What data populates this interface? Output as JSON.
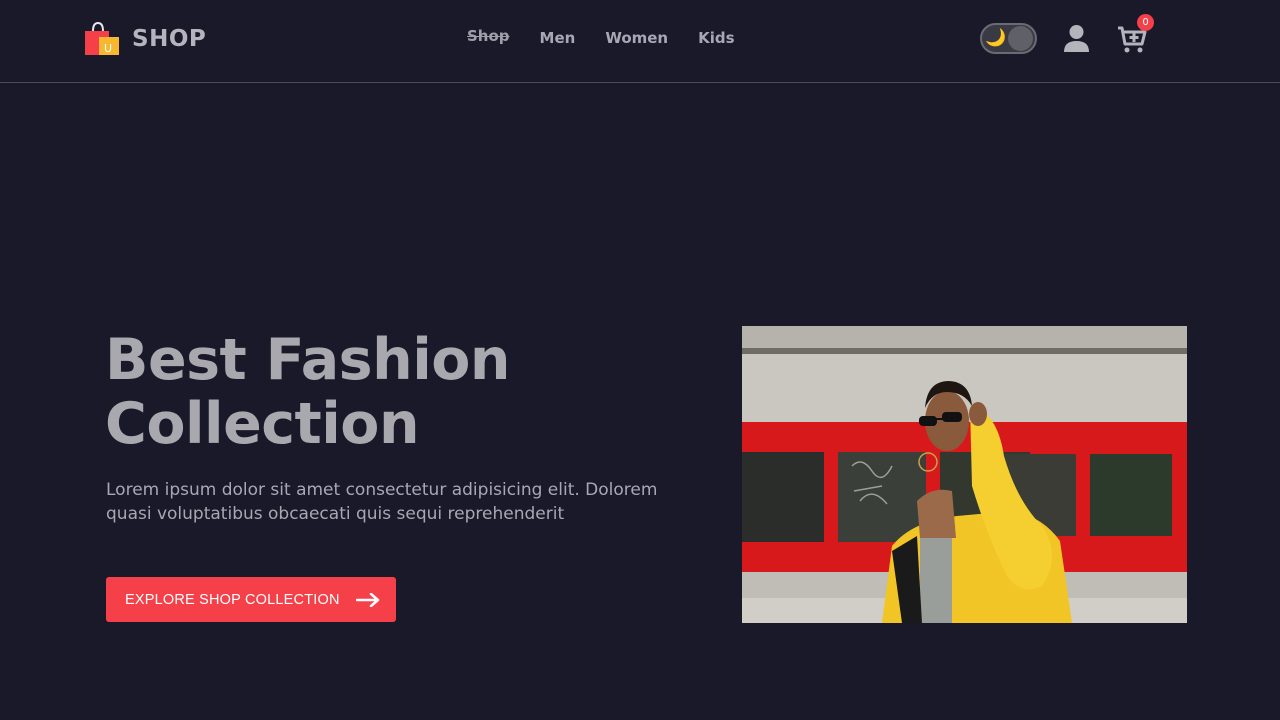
{
  "header": {
    "logo_text": "SHOP",
    "logo_badge_letter": "U",
    "nav": [
      {
        "label": "Shop",
        "active": true
      },
      {
        "label": "Men"
      },
      {
        "label": "Women"
      },
      {
        "label": "Kids"
      }
    ],
    "theme_toggle_icon": "moon-icon",
    "cart_count": "0"
  },
  "hero": {
    "title_line1": "Best Fashion",
    "title_line2": "Collection",
    "description": "Lorem ipsum dolor sit amet consectetur adipisicing elit. Dolorem quasi voluptatibus obcaecati quis sequi reprehenderit",
    "cta_label": "EXPLORE SHOP COLLECTION",
    "cta_icon": "arrow-right-icon",
    "image_icon": "fashion-model-photo"
  },
  "colors": {
    "background": "#19192a",
    "accent": "#f5404a",
    "text": "#a8a8b2"
  }
}
